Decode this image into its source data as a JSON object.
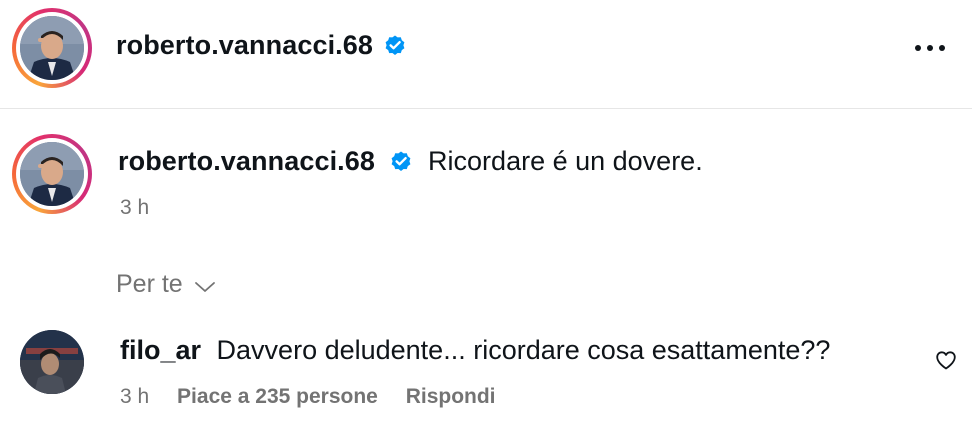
{
  "header": {
    "username": "roberto.vannacci.68"
  },
  "post": {
    "username": "roberto.vannacci.68",
    "caption": "Ricordare é un dovere.",
    "time": "3 h"
  },
  "sort": {
    "label": "Per te"
  },
  "comment": {
    "username": "filo_ar",
    "text": "Davvero deludente... ricordare cosa esattamente??",
    "time": "3 h",
    "likes": "Piace a 235 persone",
    "reply": "Rispondi"
  },
  "icons": {
    "verified": "verified-badge-icon",
    "more": "more-options-icon",
    "chevron": "chevron-down-icon",
    "like": "heart-icon"
  },
  "colors": {
    "verified": "#0095f6",
    "secondary_text": "#737373",
    "text": "#0f1419"
  }
}
